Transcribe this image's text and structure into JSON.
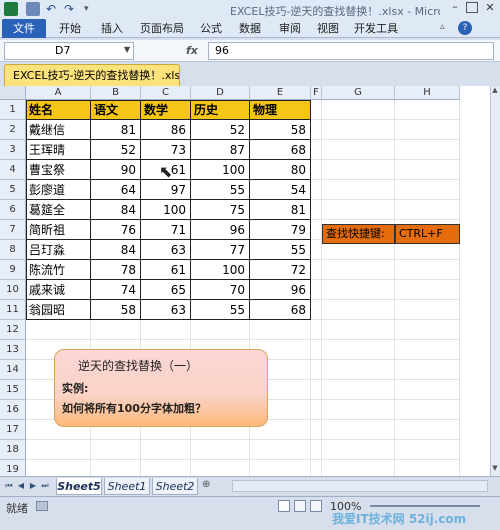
{
  "window": {
    "title": "EXCEL技巧-逆天的查找替换！.xlsx - Microsoft Excel"
  },
  "ribbon": {
    "file_tab": "文件",
    "tabs": [
      "开始",
      "插入",
      "页面布局",
      "公式",
      "数据",
      "审阅",
      "视图",
      "开发工具"
    ]
  },
  "formula_bar": {
    "name_box": "D7",
    "fx": "fx",
    "value": "96"
  },
  "workbook_tab": "EXCEL技巧-逆天的查找替换！.xlsx",
  "columns": [
    "A",
    "B",
    "C",
    "D",
    "E",
    "F",
    "G",
    "H"
  ],
  "rows": [
    "1",
    "2",
    "3",
    "4",
    "5",
    "6",
    "7",
    "8",
    "9",
    "10",
    "11",
    "12",
    "13",
    "14",
    "15",
    "16",
    "17",
    "18",
    "19"
  ],
  "table": {
    "headers": [
      "姓名",
      "语文",
      "数学",
      "历史",
      "物理"
    ],
    "rows": [
      [
        "戴继信",
        "81",
        "86",
        "52",
        "58"
      ],
      [
        "王珲晴",
        "52",
        "73",
        "87",
        "68"
      ],
      [
        "曹宝祭",
        "90",
        "61",
        "100",
        "80"
      ],
      [
        "彭廖道",
        "64",
        "97",
        "55",
        "54"
      ],
      [
        "葛筵全",
        "84",
        "100",
        "75",
        "81"
      ],
      [
        "简昕祖",
        "76",
        "71",
        "96",
        "79"
      ],
      [
        "吕玎淼",
        "84",
        "63",
        "77",
        "55"
      ],
      [
        "陈流竹",
        "78",
        "61",
        "100",
        "72"
      ],
      [
        "戚来诚",
        "74",
        "65",
        "70",
        "96"
      ],
      [
        "翁园昭",
        "58",
        "63",
        "55",
        "68"
      ]
    ]
  },
  "shortcut": {
    "label": "查找快捷键:",
    "value": "CTRL+F"
  },
  "callout": {
    "title": "逆天的查找替换（一）",
    "line1": "实例:",
    "line2": "如何将所有100分字体加粗？"
  },
  "sheet_tabs": [
    "Sheet5",
    "Sheet1",
    "Sheet2"
  ],
  "status": {
    "ready": "就绪",
    "zoom": "100%"
  },
  "watermark": "我爱IT技术网 52ij.com",
  "colors": {
    "header_fill": "#f5c518",
    "shortcut_fill": "#e46c0a",
    "file_tab": "#2a62b8"
  }
}
